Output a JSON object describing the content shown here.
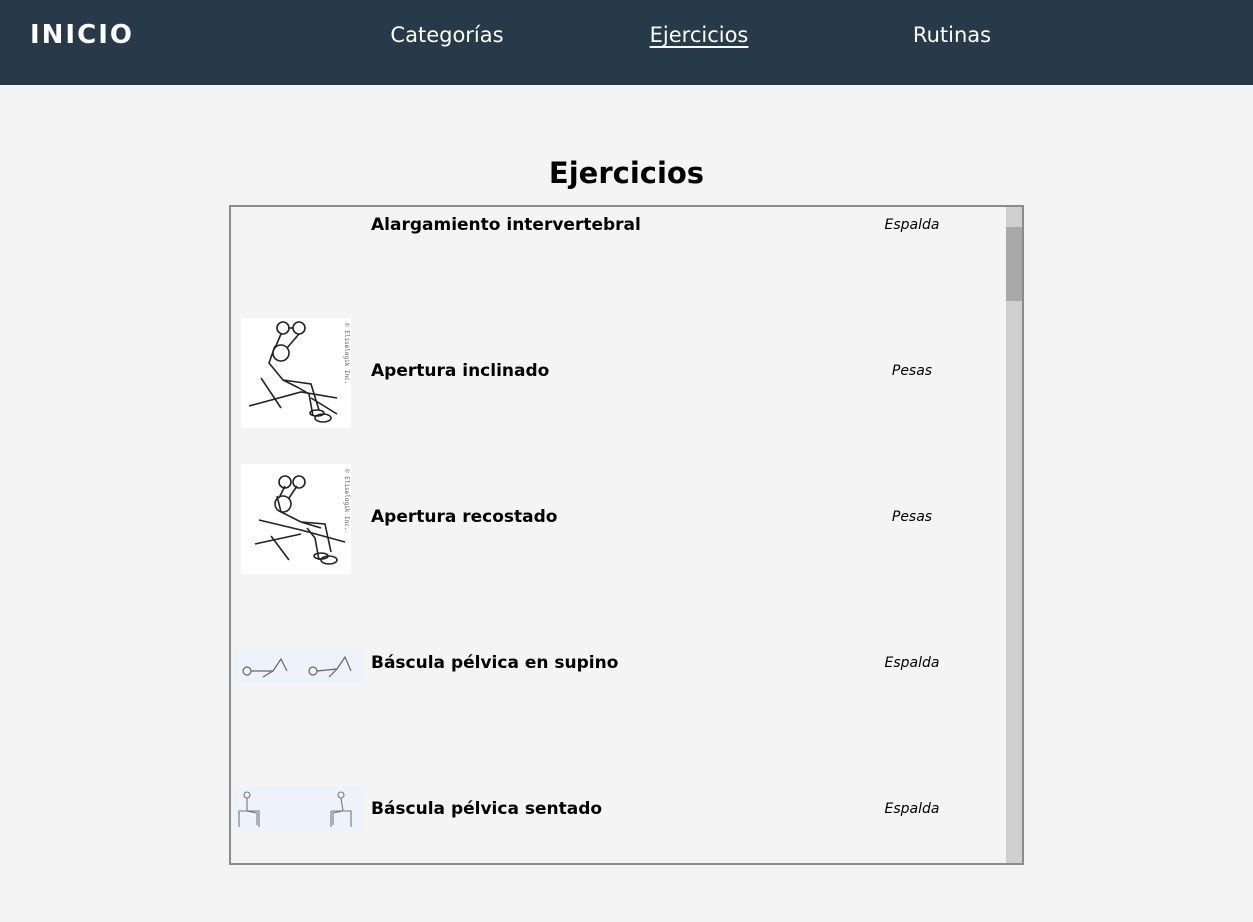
{
  "nav": {
    "brand": "INICIO",
    "links": [
      "Categorías",
      "Ejercicios",
      "Rutinas"
    ],
    "active": "Ejercicios"
  },
  "page_title": "Ejercicios",
  "exercises": [
    {
      "name": "Alargamiento intervertebral",
      "category": "Espalda",
      "image": "none"
    },
    {
      "name": "Apertura inclinado",
      "category": "Pesas",
      "image": "dumbbell-incline-drawing"
    },
    {
      "name": "Apertura recostado",
      "category": "Pesas",
      "image": "dumbbell-bench-drawing"
    },
    {
      "name": "Báscula pélvica en supino",
      "category": "Espalda",
      "image": "supine-pelvic-tilt-drawing"
    },
    {
      "name": "Báscula pélvica sentado",
      "category": "Espalda",
      "image": "seated-pelvic-tilt-drawing"
    }
  ],
  "colors": {
    "navbar": "#263a4a",
    "background": "#f4f4f4",
    "border": "#8b8b8b"
  }
}
